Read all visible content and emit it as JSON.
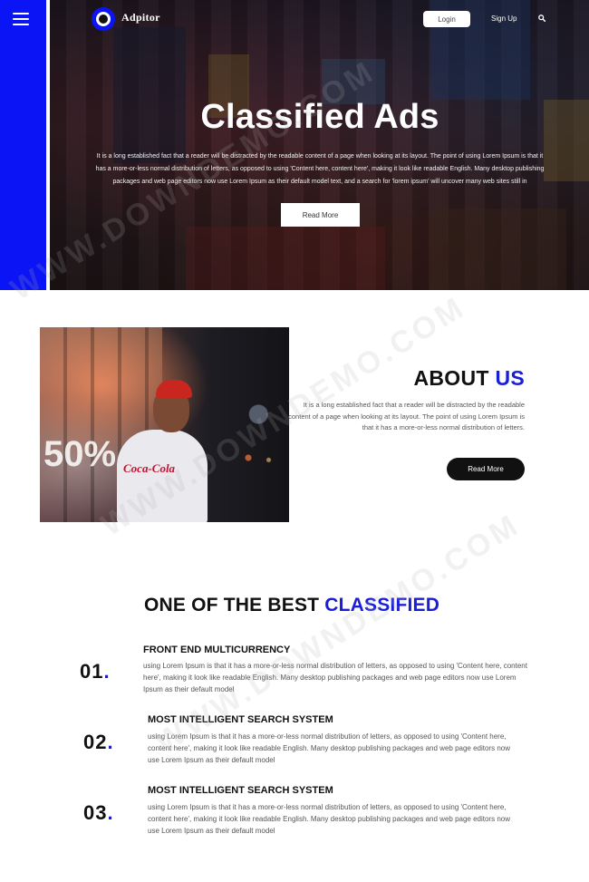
{
  "header": {
    "brand": "Adpitor",
    "login_label": "Login",
    "signup_label": "Sign Up",
    "menu_icon": "hamburger-menu-icon",
    "search_icon": "search-icon"
  },
  "hero": {
    "title": "Classified Ads",
    "text": "It is a long established fact that a reader will be distracted by the readable content of a page when looking at its layout. The point of using Lorem Ipsum is that it has a more-or-less normal distribution of letters, as opposed to using 'Content here, content here', making it look like readable English. Many desktop publishing packages and web page editors now use Lorem Ipsum as their default model text, and a search for 'lorem ipsum' will uncover many web sites still in",
    "button_label": "Read More"
  },
  "about": {
    "title_main": "ABOUT",
    "title_accent": "US",
    "text": "It is a long established fact that a reader will be distracted by the readable content of a page when looking at its layout. The point of using Lorem Ipsum is that it has a more-or-less normal distribution of letters.",
    "button_label": "Read More",
    "photo_sign_text": "50%",
    "photo_shirt_text": "Coca-Cola"
  },
  "features": {
    "title_main": "ONE OF THE BEST",
    "title_accent": "CLASSIFIED",
    "items": [
      {
        "num": "01",
        "title": "FRONT END MULTICURRENCY",
        "text": "using Lorem Ipsum is that it has a more-or-less normal distribution of letters, as opposed to using 'Content here, content here', making it look like readable English. Many desktop publishing packages and web page editors now use Lorem Ipsum as their default model"
      },
      {
        "num": "02",
        "title": "MOST INTELLIGENT SEARCH SYSTEM",
        "text": "using Lorem Ipsum is that it has a more-or-less normal distribution of letters, as opposed to using 'Content here, content here', making it look like readable English. Many desktop publishing packages and web page editors now use Lorem Ipsum as their default model"
      },
      {
        "num": "03",
        "title": "MOST INTELLIGENT SEARCH SYSTEM",
        "text": "using Lorem Ipsum is that it has a more-or-less normal distribution of letters, as opposed to using 'Content here, content here', making it look like readable English. Many desktop publishing packages and web page editors now use Lorem Ipsum as their default model"
      }
    ]
  },
  "watermark": "WWW.DOWNDEMO.COM",
  "colors": {
    "accent_blue": "#1a1fd6",
    "sidebar_blue": "#0a14f5",
    "dark_button": "#111111"
  }
}
